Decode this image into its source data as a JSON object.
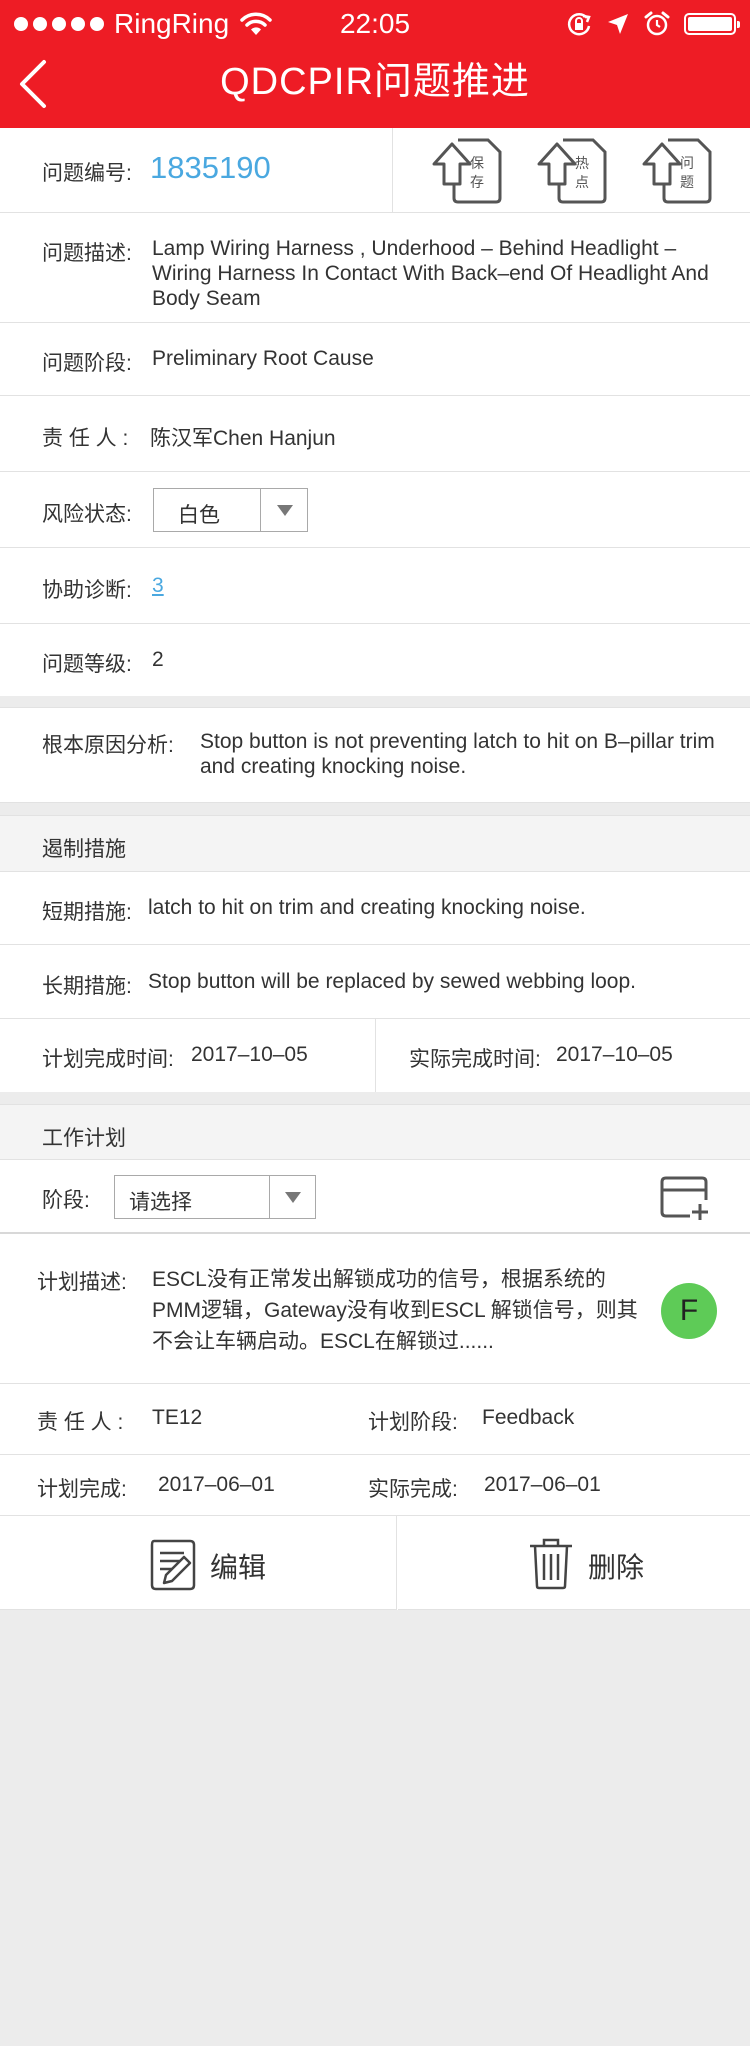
{
  "status_bar": {
    "carrier": "RingRing",
    "time": "22:05",
    "icons": [
      "signal-dots-icon",
      "wifi-icon",
      "orientation-lock-icon",
      "location-arrow-icon",
      "alarm-icon",
      "battery-icon"
    ]
  },
  "nav": {
    "title": "QDCPIR问题推进",
    "back_icon": "chevron-left-icon"
  },
  "colors": {
    "brand_red": "#ee1c25",
    "link_blue": "#4aa8e0",
    "avatar_green": "#5ecb57"
  },
  "issue": {
    "number_label": "问题编号:",
    "number": "1835190",
    "actions": [
      {
        "label": "保存",
        "icon": "upload-arrow-icon"
      },
      {
        "label": "热点",
        "icon": "upload-arrow-icon"
      },
      {
        "label": "问题",
        "icon": "upload-arrow-icon"
      }
    ],
    "description_label": "问题描述:",
    "description": "Lamp Wiring Harness , Underhood – Behind Headlight – Wiring Harness In Contact With Back–end Of Headlight And Body Seam",
    "stage_label": "问题阶段:",
    "stage": "Preliminary Root Cause",
    "owner_label": "责 任 人 :",
    "owner": "陈汉军Chen Hanjun",
    "risk_label": "风险状态:",
    "risk_value": "白色",
    "assist_label": "协助诊断:",
    "assist_value": "3",
    "level_label": "问题等级:",
    "level": "2",
    "root_cause_label": "根本原因分析:",
    "root_cause": "Stop button is not preventing latch to hit on B–pillar trim and creating knocking noise."
  },
  "containment": {
    "section_title": "遏制措施",
    "short_label": "短期措施:",
    "short_value": "latch to hit on  trim and creating knocking noise.",
    "long_label": "长期措施:",
    "long_value": "Stop button will be replaced by sewed webbing loop.",
    "planned_label": "计划完成时间:",
    "planned_date": "2017–10–05",
    "actual_label": "实际完成时间:",
    "actual_date": "2017–10–05"
  },
  "work_plan": {
    "section_title": "工作计划",
    "stage_label": "阶段:",
    "stage_placeholder": "请选择",
    "add_icon": "add-plan-icon",
    "plan_desc_label": "计划描述:",
    "plan_desc": "ESCL没有正常发出解锁成功的信号，根据系统的PMM逻辑，Gateway没有收到ESCL  解锁信号，则其不会让车辆启动。ESCL在解锁过......",
    "avatar_letter": "F",
    "owner_label": "责 任 人 :",
    "owner": "TE12",
    "plan_stage_label": "计划阶段:",
    "plan_stage": "Feedback",
    "planned_label": "计划完成:",
    "planned_date": "2017–06–01",
    "actual_label": "实际完成:",
    "actual_date": "2017–06–01",
    "edit_label": "编辑",
    "edit_icon": "edit-note-icon",
    "delete_label": "删除",
    "delete_icon": "trash-icon"
  }
}
